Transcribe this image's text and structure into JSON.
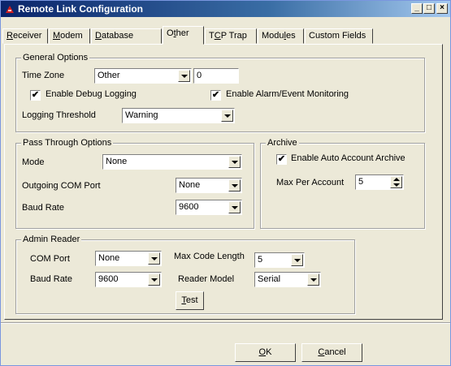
{
  "window": {
    "title": "Remote Link Configuration"
  },
  "tabs": [
    {
      "label": "Receiver",
      "key": "R",
      "rest": "eceiver"
    },
    {
      "label": "Modem",
      "key": "M",
      "rest": "odem"
    },
    {
      "label": "Database",
      "key": "D",
      "rest": "atabase"
    },
    {
      "label": "Other",
      "pre": "O",
      "key": "t",
      "rest": "her"
    },
    {
      "label": "TCP Trap",
      "pre": "T",
      "key": "C",
      "rest": "P Trap"
    },
    {
      "label": "Modules",
      "pre": "Modu",
      "key": "l",
      "rest": "es"
    },
    {
      "label": "Custom Fields"
    }
  ],
  "general": {
    "legend": "General Options",
    "timezone_label": "Time Zone",
    "timezone_value": "Other",
    "timezone_offset": "0",
    "debug_label": "Enable Debug Logging",
    "debug_checked": true,
    "alarm_label": "Enable Alarm/Event Monitoring",
    "alarm_checked": true,
    "threshold_label": "Logging Threshold",
    "threshold_value": "Warning"
  },
  "passthrough": {
    "legend": "Pass Through Options",
    "mode_label": "Mode",
    "mode_value": "None",
    "com_label": "Outgoing COM Port",
    "com_value": "None",
    "baud_label": "Baud Rate",
    "baud_value": "9600"
  },
  "archive": {
    "legend": "Archive",
    "auto_label": "Enable Auto Account Archive",
    "auto_checked": true,
    "max_label": "Max Per Account",
    "max_value": "5"
  },
  "admin": {
    "legend": "Admin Reader",
    "com_label": "COM Port",
    "com_value": "None",
    "baud_label": "Baud Rate",
    "baud_value": "9600",
    "maxcode_label": "Max Code Length",
    "maxcode_value": "5",
    "model_label": "Reader Model",
    "model_value": "Serial",
    "test_key": "T",
    "test_rest": "est"
  },
  "buttons": {
    "ok_key": "O",
    "ok_rest": "K",
    "cancel_key": "C",
    "cancel_rest": "ancel"
  },
  "check_mark": "✔"
}
